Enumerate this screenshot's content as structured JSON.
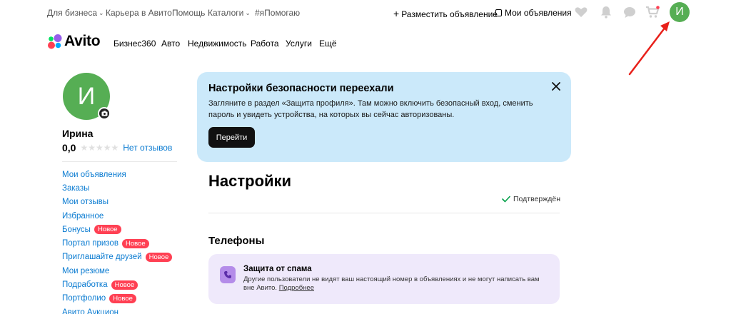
{
  "topbar": {
    "links": [
      {
        "label": "Для бизнеса",
        "has_chevron": true
      },
      {
        "label": "Карьера в Авито",
        "has_chevron": false
      },
      {
        "label": "Помощь",
        "has_chevron": false
      },
      {
        "label": "Каталоги",
        "has_chevron": true
      },
      {
        "label": "#яПомогаю",
        "has_chevron": false
      }
    ],
    "post_ad_label": "Разместить объявление",
    "my_ads_label": "Мои объявления",
    "icons": [
      "heart-icon",
      "bell-icon",
      "chat-icon",
      "cart-icon"
    ],
    "user_initial": "И"
  },
  "header": {
    "logo_text": "Avito",
    "nav": [
      "Бизнес360",
      "Авто",
      "Недвижимость",
      "Работа",
      "Услуги",
      "Ещё"
    ]
  },
  "profile": {
    "initial": "И",
    "name": "Ирина",
    "rating": "0,0",
    "reviews_link": "Нет отзывов"
  },
  "sidebar": {
    "items": [
      {
        "label": "Мои объявления",
        "badge": ""
      },
      {
        "label": "Заказы",
        "badge": ""
      },
      {
        "label": "Мои отзывы",
        "badge": ""
      },
      {
        "label": "Избранное",
        "badge": ""
      },
      {
        "label": "Бонусы",
        "badge": "Новое"
      },
      {
        "label": "Портал призов",
        "badge": "Новое"
      },
      {
        "label": "Приглашайте друзей",
        "badge": "Новое"
      },
      {
        "label": "Мои резюме",
        "badge": ""
      },
      {
        "label": "Подработка",
        "badge": "Новое"
      },
      {
        "label": "Портфолио",
        "badge": "Новое"
      },
      {
        "label": "Авито Аукцион",
        "badge": ""
      }
    ]
  },
  "banner": {
    "title": "Настройки безопасности переехали",
    "text": "Загляните в раздел «Защита профиля». Там можно включить безопасный вход, сменить пароль и увидеть устройства, на которых вы сейчас авторизованы.",
    "button_label": "Перейти"
  },
  "main": {
    "title": "Настройки",
    "verified_label": "Подтверждён",
    "phones_title": "Телефоны",
    "spam": {
      "title": "Защита от спама",
      "text": "Другие пользователи не видят ваш настоящий номер в объявлениях и не могут написать вам вне Авито.",
      "more_link": "Подробнее"
    }
  },
  "colors": {
    "accent_green": "#56ae54",
    "link_blue": "#0a7bd1",
    "badge_red": "#ff4053",
    "banner_bg": "#cbe9fa",
    "spam_bg": "#efe9fb",
    "annotation_red": "#e8201a"
  }
}
